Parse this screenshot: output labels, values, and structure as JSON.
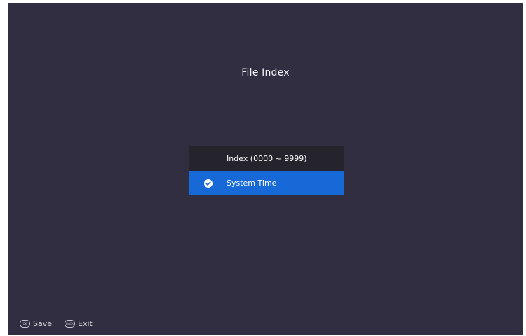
{
  "screen": {
    "title": "File Index"
  },
  "menu": {
    "items": [
      {
        "label": "Index (0000 ~ 9999)",
        "selected": false
      },
      {
        "label": "System Time",
        "selected": true
      }
    ]
  },
  "footer": {
    "save": {
      "key_icon_text": "OK",
      "label": "Save"
    },
    "exit": {
      "key_icon_text": "BACK",
      "label": "Exit"
    }
  },
  "colors": {
    "background": "#322e42",
    "menu_item_bg": "#25232b",
    "selected_bg": "#1769d8",
    "text": "#ffffff"
  },
  "icons": {
    "selected_marker": "check-circle-icon",
    "save_key": "ok-button-icon",
    "exit_key": "back-button-icon"
  }
}
